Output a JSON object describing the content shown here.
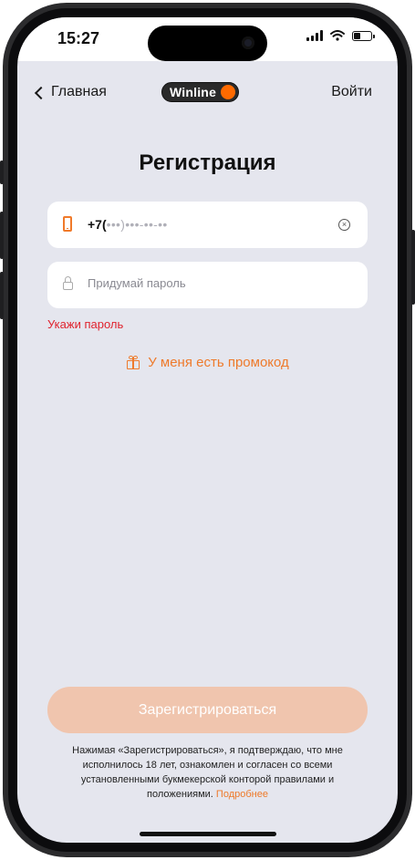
{
  "status_bar": {
    "time": "15:27",
    "icons": [
      "signal-icon",
      "wifi-icon",
      "battery-icon"
    ]
  },
  "nav": {
    "back_label": "Главная",
    "logo_text": "Winline",
    "login_label": "Войти"
  },
  "page": {
    "title": "Регистрация"
  },
  "phone_field": {
    "prefix": "+7(",
    "mask": "•••)•••-••-••"
  },
  "password_field": {
    "placeholder": "Придумай пароль",
    "value": ""
  },
  "error_text": "Укажи пароль",
  "promo_label": "У меня есть промокод",
  "register_button": "Зарегистрироваться",
  "disclaimer": {
    "text": "Нажимая «Зарегистрироваться», я подтверждаю, что мне исполнилось 18 лет, ознакомлен и согласен со всеми установленными букмекерской конторой правилами и положениями.",
    "link": "Подробнее"
  },
  "colors": {
    "accent": "#ee7a2b",
    "error": "#e0232e",
    "background": "#e5e6ee",
    "button_disabled": "#f0c5ae"
  }
}
